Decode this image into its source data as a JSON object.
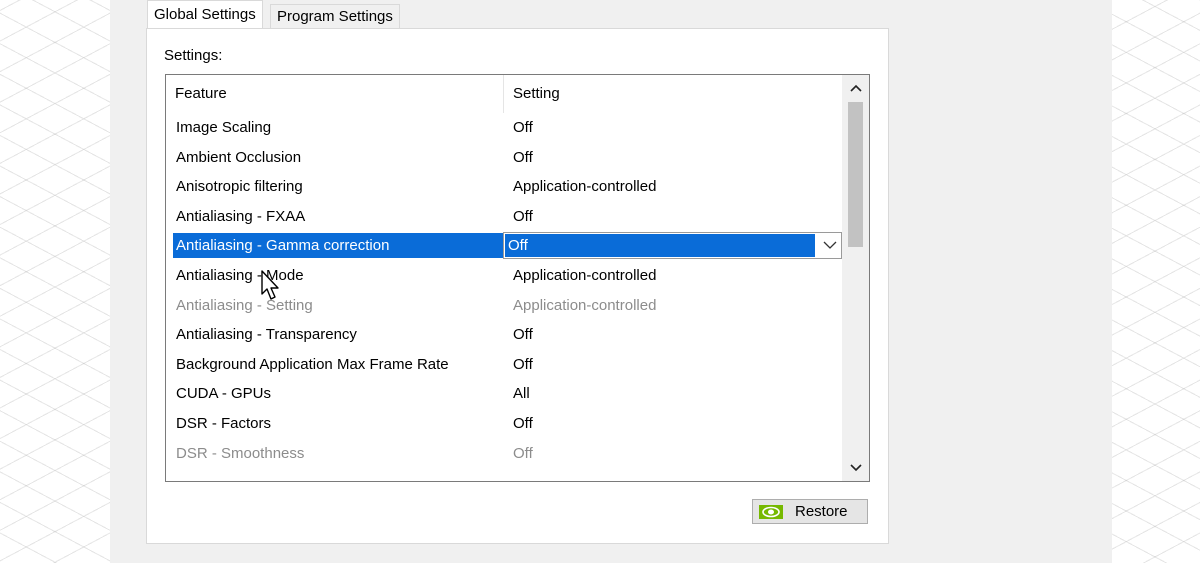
{
  "tabs": [
    {
      "label": "Global Settings",
      "active": true
    },
    {
      "label": "Program Settings",
      "active": false
    }
  ],
  "panel": {
    "label": "Settings:"
  },
  "table": {
    "columns": [
      "Feature",
      "Setting"
    ],
    "rows": [
      {
        "feature": "Image Scaling",
        "setting": "Off"
      },
      {
        "feature": "Ambient Occlusion",
        "setting": "Off"
      },
      {
        "feature": "Anisotropic filtering",
        "setting": "Application-controlled"
      },
      {
        "feature": "Antialiasing - FXAA",
        "setting": "Off"
      },
      {
        "feature": "Antialiasing - Gamma correction",
        "setting": "Off"
      },
      {
        "feature": "Antialiasing - Mode",
        "setting": "Application-controlled"
      },
      {
        "feature": "Antialiasing - Setting",
        "setting": "Application-controlled"
      },
      {
        "feature": "Antialiasing - Transparency",
        "setting": "Off"
      },
      {
        "feature": "Background Application Max Frame Rate",
        "setting": "Off"
      },
      {
        "feature": "CUDA - GPUs",
        "setting": "All"
      },
      {
        "feature": "DSR - Factors",
        "setting": "Off"
      },
      {
        "feature": "DSR - Smoothness",
        "setting": "Off"
      }
    ],
    "selected_dropdown_value": "Off"
  },
  "buttons": {
    "restore": "Restore"
  },
  "colors": {
    "selection": "#0a6cd8",
    "disabled_text": "#8c8c8c",
    "nvidia_green": "#76b900"
  },
  "icons": {
    "restore": "nvidia-logo-icon",
    "scroll_up": "chevron-up-icon",
    "scroll_down": "chevron-down-icon",
    "dropdown": "chevron-down-icon",
    "cursor": "mouse-pointer-icon"
  }
}
